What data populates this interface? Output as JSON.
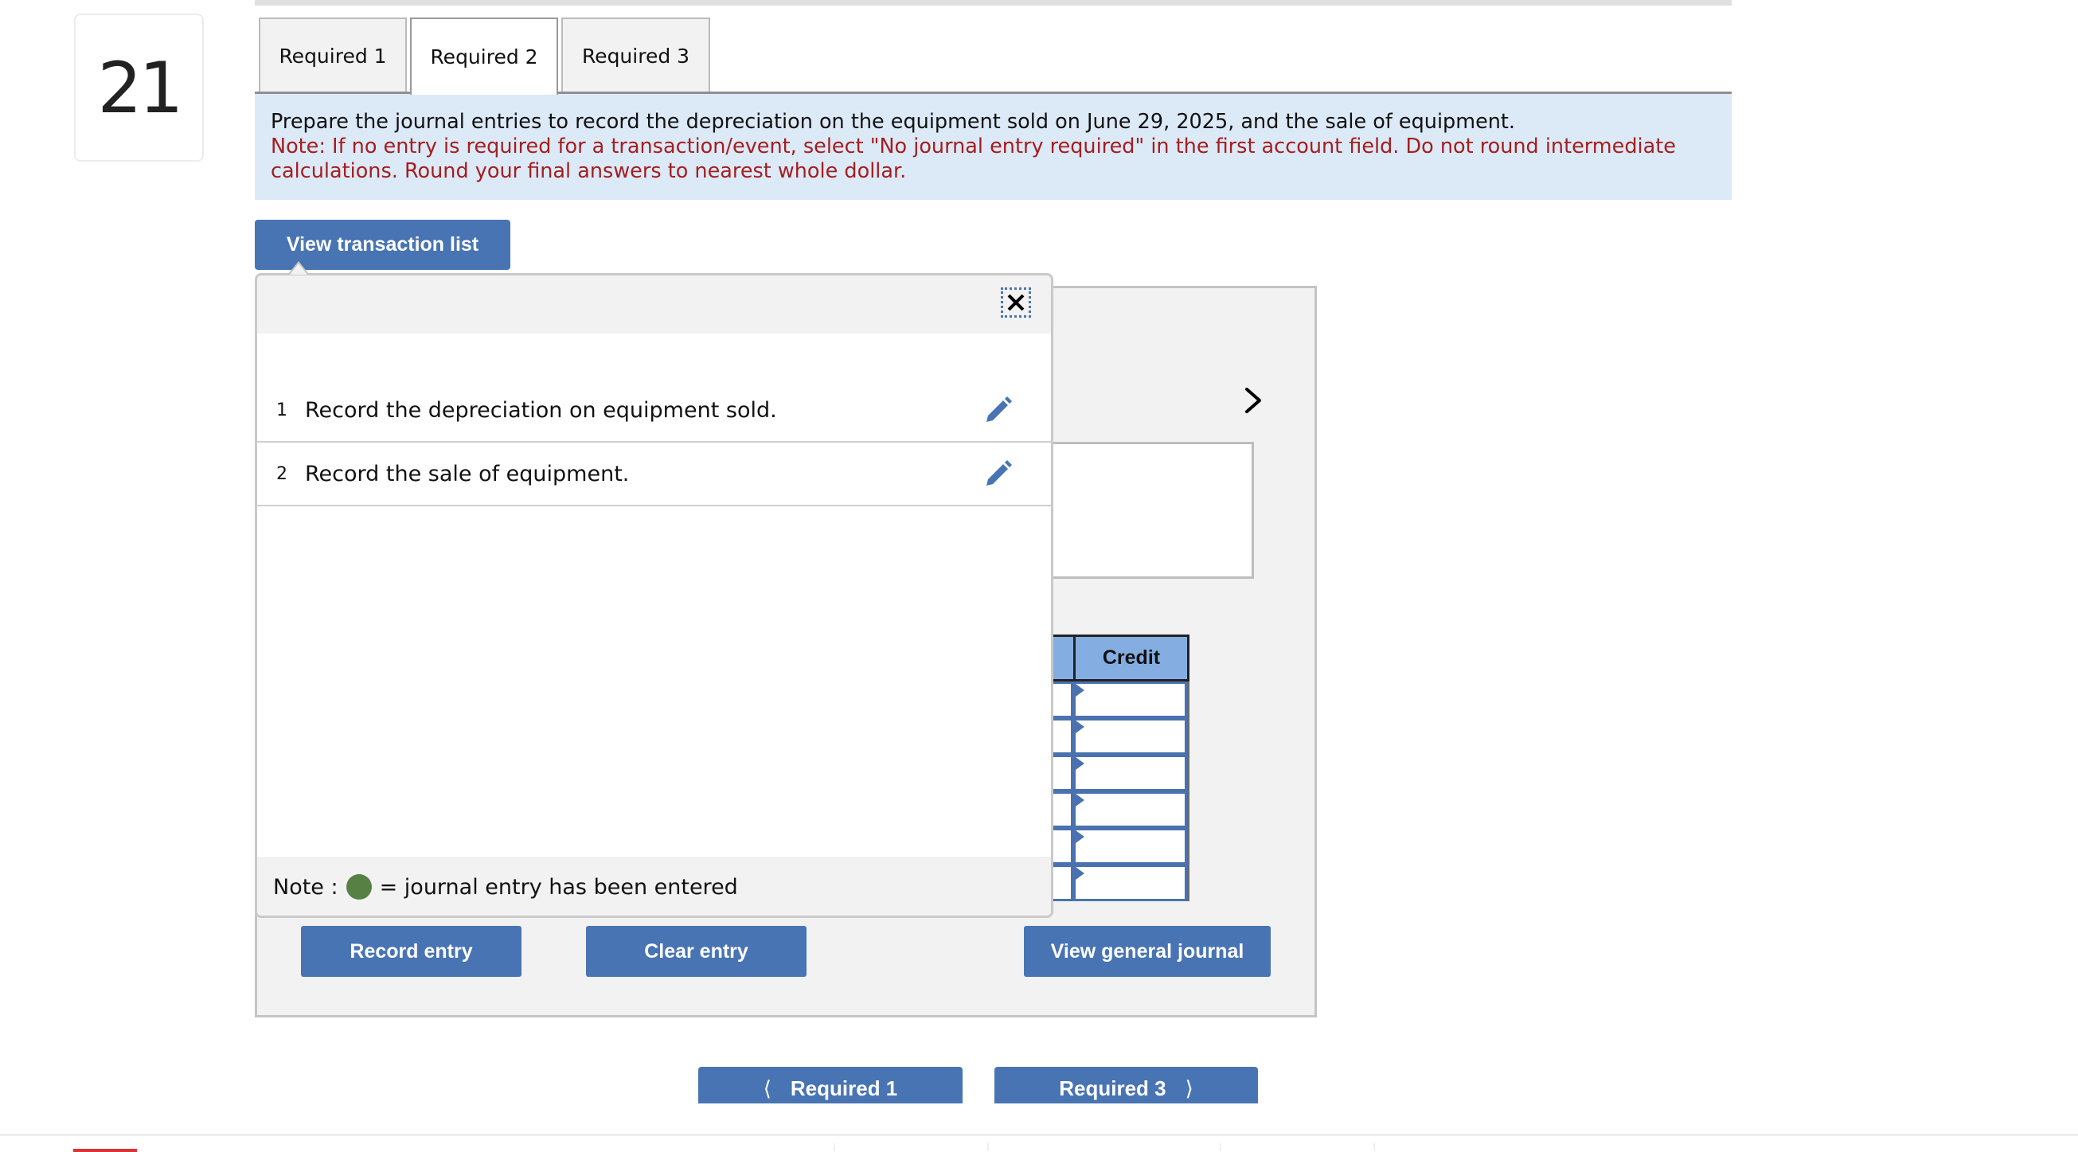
{
  "question_number": "21",
  "tabs": [
    {
      "label": "Required 1",
      "active": false
    },
    {
      "label": "Required 2",
      "active": true
    },
    {
      "label": "Required 3",
      "active": false
    }
  ],
  "instructions": {
    "main": "Prepare the journal entries to record the depreciation on the equipment sold on June 29, 2025, and the sale of equipment.",
    "note": "Note: If no entry is required for a transaction/event, select \"No journal entry required\" in the first account field. Do not round intermediate calculations. Round your final answers to nearest whole dollar."
  },
  "view_transaction_list_label": "View transaction list",
  "popup": {
    "close_icon": "close-icon",
    "transactions": [
      {
        "number": "1",
        "label": "Record the depreciation on equipment sold.",
        "icon": "pencil-icon"
      },
      {
        "number": "2",
        "label": "Record the sale of equipment.",
        "icon": "pencil-icon"
      }
    ],
    "note_prefix": "Note :",
    "note_suffix": "= journal entry has been entered",
    "entered_color": "#568044"
  },
  "journal": {
    "credit_header": "Credit",
    "row_count": 6
  },
  "buttons": {
    "record_entry": "Record entry",
    "clear_entry": "Clear entry",
    "view_general_journal": "View general journal"
  },
  "nav": {
    "prev_label": "Required 1",
    "next_label": "Required 3"
  },
  "colors": {
    "accent": "#4874b3",
    "instruction_bg": "#dce9f7",
    "note_red": "#a31f1f",
    "grid_header": "#84aee2"
  }
}
